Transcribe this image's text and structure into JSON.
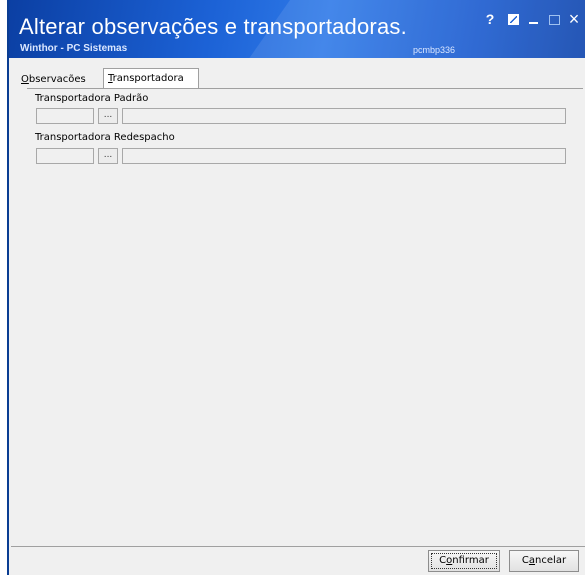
{
  "window": {
    "title": "Alterar observações e transportadoras.",
    "app_name": "Winthor - PC Sistemas",
    "program_code": "pcmbp336",
    "help_label": "?",
    "close_label": "×"
  },
  "tabs": {
    "observacoes": {
      "mnemonic": "O",
      "rest": "bservacões"
    },
    "transportadora": {
      "mnemonic": "T",
      "rest": "ransportadora"
    },
    "active": "Transportadora"
  },
  "fields": {
    "padrao": {
      "label": "Transportadora Padrão",
      "code": "",
      "description": "",
      "lookup": "..."
    },
    "redespacho": {
      "label": "Transportadora Redespacho",
      "code": "",
      "description": "",
      "lookup": "..."
    }
  },
  "buttons": {
    "confirm": {
      "pre": "C",
      "mnemonic": "o",
      "rest": "nfirmar"
    },
    "cancel": {
      "pre": "C",
      "mnemonic": "a",
      "rest": "ncelar"
    }
  }
}
